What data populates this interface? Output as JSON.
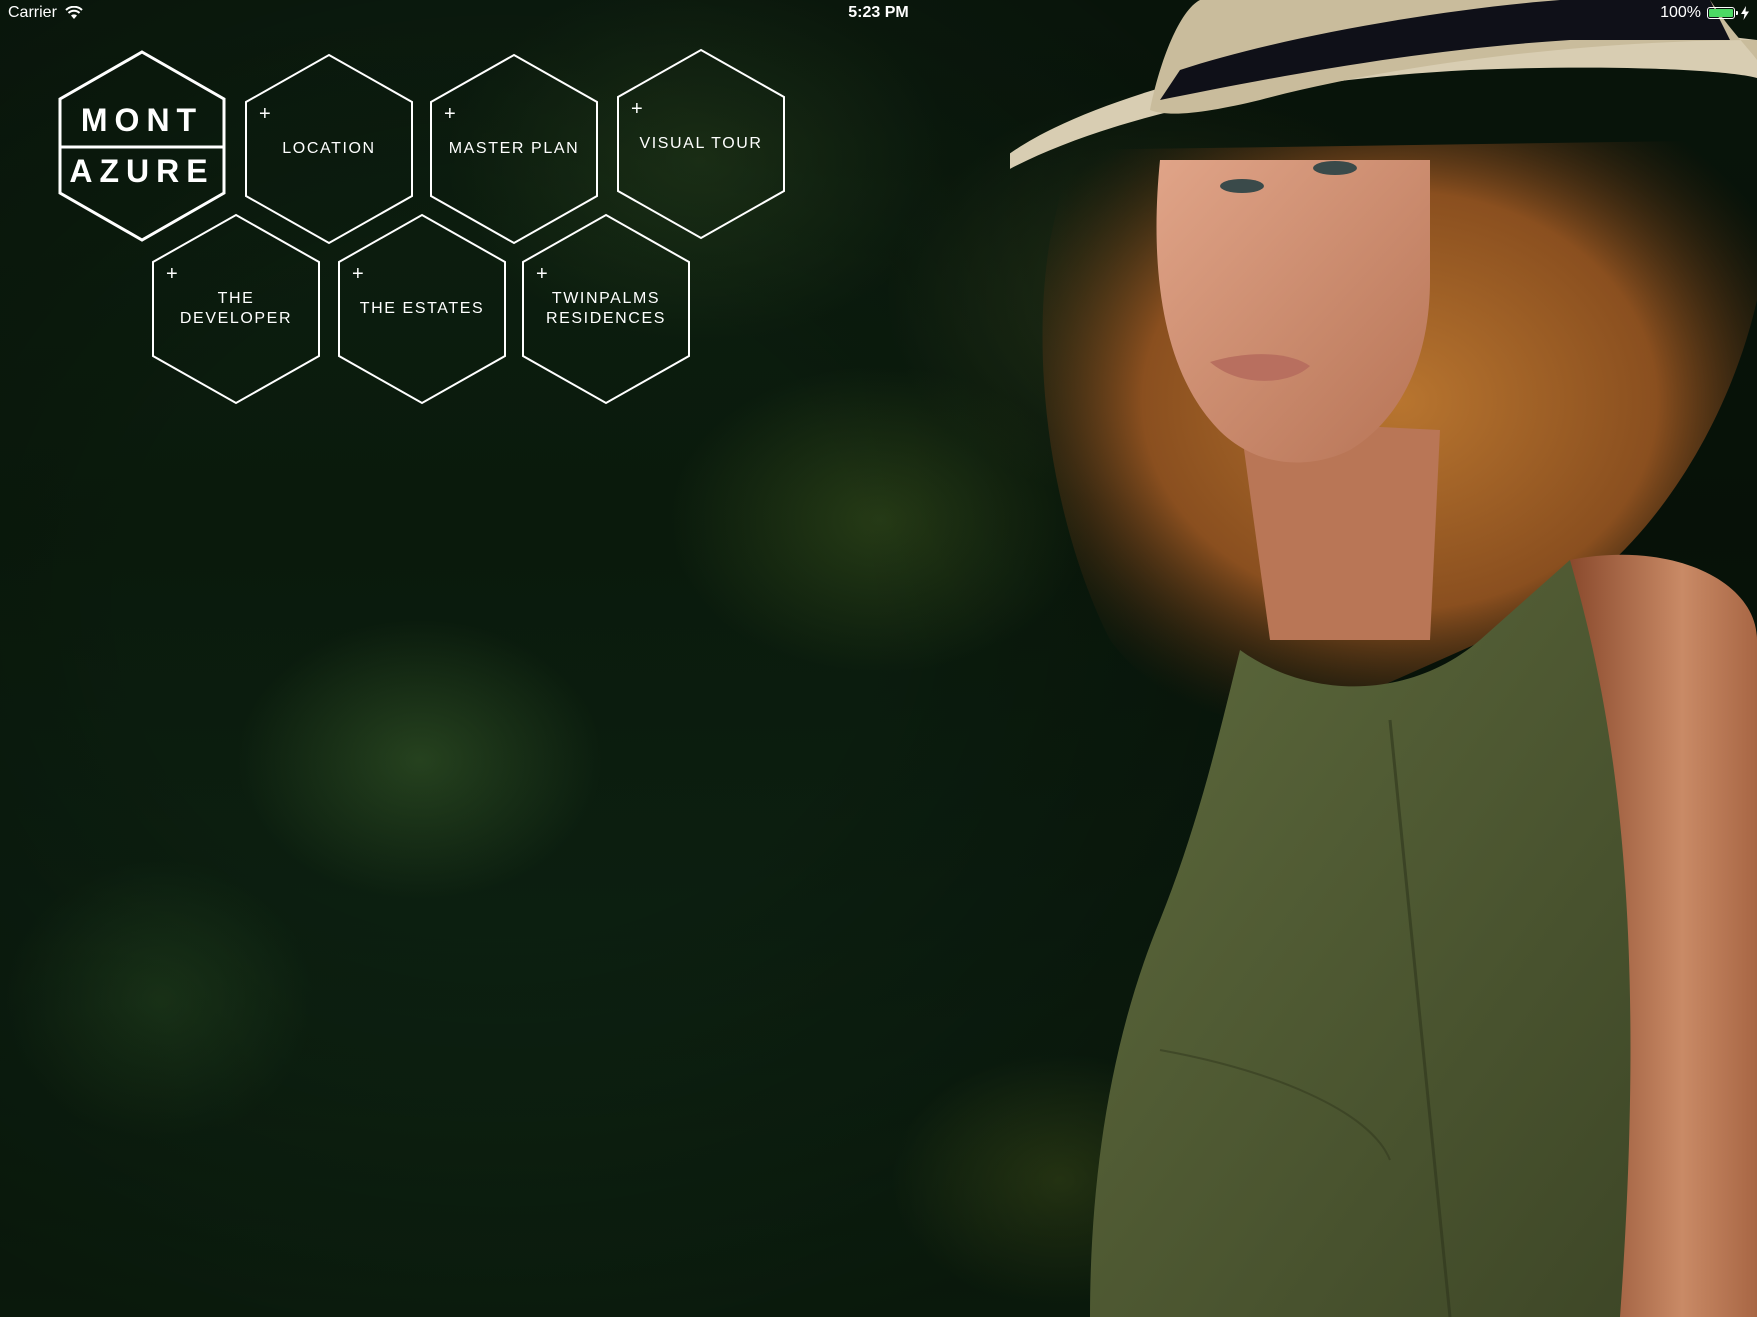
{
  "status_bar": {
    "carrier": "Carrier",
    "time": "5:23 PM",
    "battery": "100%",
    "battery_level": 1.0,
    "battery_color": "#4cd964"
  },
  "brand": {
    "line1": "MONT",
    "line2": "AZURE"
  },
  "menu": {
    "items": [
      {
        "label": "LOCATION",
        "icon": "plus-icon"
      },
      {
        "label": "MASTER PLAN",
        "icon": "plus-icon"
      },
      {
        "label": "VISUAL TOUR",
        "icon": "plus-icon"
      },
      {
        "label": "THE DEVELOPER",
        "icon": "plus-icon"
      },
      {
        "label": "THE ESTATES",
        "icon": "plus-icon"
      },
      {
        "label": "TWINPALMS\nRESIDENCES",
        "icon": "plus-icon"
      }
    ],
    "plus_glyph": "+"
  },
  "colors": {
    "outline": "#ffffff",
    "background": "#0b1a0d"
  }
}
